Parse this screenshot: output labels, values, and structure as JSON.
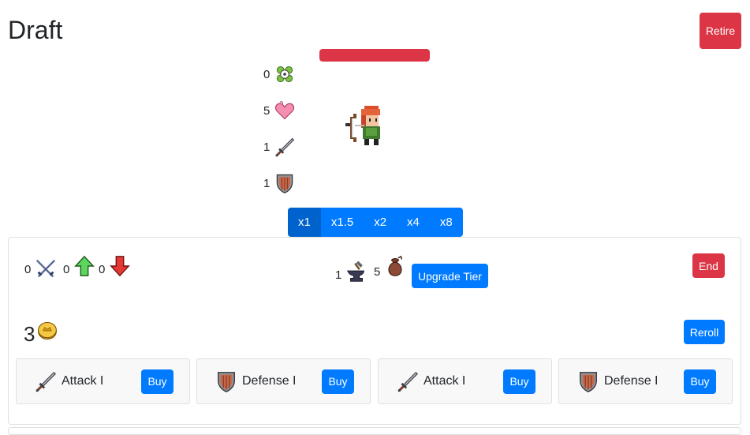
{
  "header": {
    "title": "Draft",
    "retire_label": "Retire"
  },
  "hero": {
    "hp_fraction": 1.0,
    "hp_color": "#dc3545",
    "stats": [
      {
        "name": "luck",
        "icon": "clover-icon",
        "value": "0"
      },
      {
        "name": "health",
        "icon": "heart-icon",
        "value": "5"
      },
      {
        "name": "attack",
        "icon": "sword-icon",
        "value": "1"
      },
      {
        "name": "defense",
        "icon": "shield-icon",
        "value": "1"
      }
    ]
  },
  "speed": {
    "options": [
      "x1",
      "x1.5",
      "x2",
      "x4",
      "x8"
    ],
    "selected": "x1"
  },
  "shop": {
    "battle_stats": [
      {
        "icon": "crossed-swords-icon",
        "value": "0"
      },
      {
        "icon": "up-arrow-icon",
        "value": "0"
      },
      {
        "icon": "down-arrow-icon",
        "value": "0"
      }
    ],
    "tier": {
      "anvil_value": "1",
      "bag_value": "5"
    },
    "upgrade_label": "Upgrade Tier",
    "end_label": "End",
    "gold": "3",
    "reroll_label": "Reroll",
    "items": [
      {
        "icon": "sword-icon",
        "name": "Attack I",
        "buy_label": "Buy"
      },
      {
        "icon": "shield-icon",
        "name": "Defense I",
        "buy_label": "Buy"
      },
      {
        "icon": "sword-icon",
        "name": "Attack I",
        "buy_label": "Buy"
      },
      {
        "icon": "shield-icon",
        "name": "Defense I",
        "buy_label": "Buy"
      }
    ]
  },
  "colors": {
    "primary": "#007bff",
    "primary_active": "#0062cc",
    "danger": "#dc3545"
  }
}
